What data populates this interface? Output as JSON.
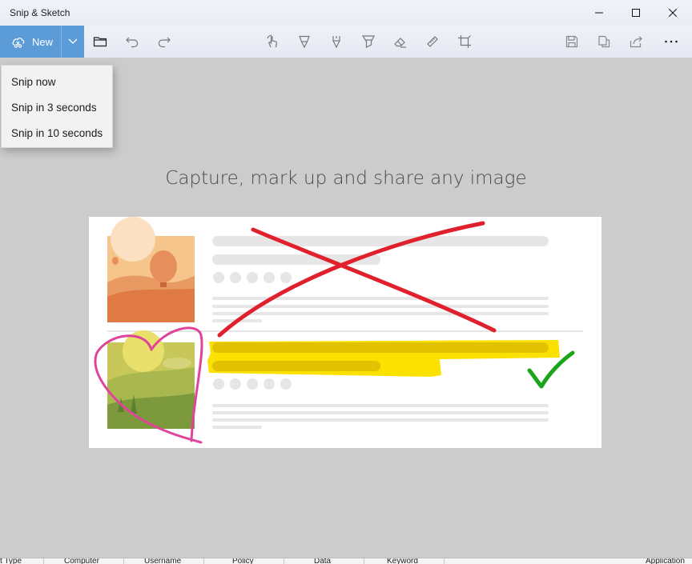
{
  "window": {
    "title": "Snip & Sketch"
  },
  "toolbar": {
    "new_label": "New",
    "icons": [
      "open-folder-icon",
      "undo-icon",
      "redo-icon",
      "touch-writing-icon",
      "ballpoint-pen-icon",
      "pencil-icon",
      "highlighter-icon",
      "eraser-icon",
      "ruler-icon",
      "crop-icon",
      "save-icon",
      "copy-icon",
      "share-icon",
      "more-icon"
    ],
    "accent": "#5a9bd8"
  },
  "new_menu": {
    "items": [
      "Snip now",
      "Snip in 3 seconds",
      "Snip in 10 seconds"
    ]
  },
  "canvas": {
    "headline": "Capture, mark up and share any image"
  },
  "taskbar_columns": [
    "t Type",
    "Computer",
    "Username",
    "Policy",
    "Data",
    "Keyword",
    "Application"
  ]
}
